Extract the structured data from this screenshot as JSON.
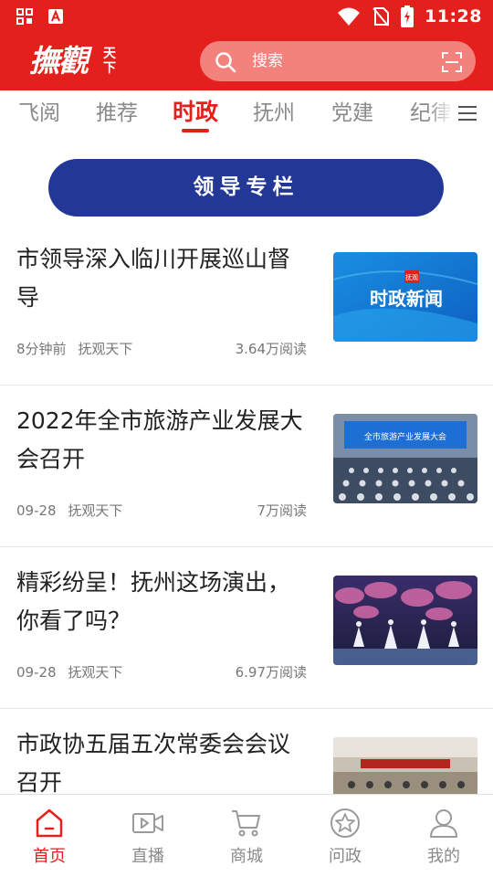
{
  "status_bar": {
    "time": "11:28",
    "left_icons": [
      "apps-icon",
      "a-logo-icon"
    ],
    "right_icons": [
      "wifi-icon",
      "no-sim-icon",
      "battery-charging-icon"
    ]
  },
  "header": {
    "logo_text": "撫觀",
    "logo_small_text": "天下",
    "search_placeholder": "搜索",
    "colors": {
      "brand_red": "#e3201b",
      "search_bg": "#f3827c"
    }
  },
  "tabs": {
    "items": [
      {
        "label": "飞阅",
        "active": false
      },
      {
        "label": "推荐",
        "active": false
      },
      {
        "label": "时政",
        "active": true
      },
      {
        "label": "抚州",
        "active": false
      },
      {
        "label": "党建",
        "active": false
      },
      {
        "label": "纪律",
        "active": false
      }
    ],
    "more_icon": "menu-icon"
  },
  "banner": {
    "label": "领导专栏",
    "color": "#223796"
  },
  "news": [
    {
      "title": "市领导深入临川开展巡山督导",
      "time": "8分钟前",
      "source": "抚观天下",
      "reads": "3.64万阅读",
      "thumb_logo": "抚观",
      "thumb_text": "时政新闻"
    },
    {
      "title": "2022年全市旅游产业发展大会召开",
      "time": "09-28",
      "source": "抚观天下",
      "reads": "7万阅读",
      "thumb_text": "全市旅游产业发展大会"
    },
    {
      "title": "精彩纷呈！抚州这场演出，你看了吗？",
      "time": "09-28",
      "source": "抚观天下",
      "reads": "6.97万阅读"
    },
    {
      "title": "市政协五届五次常委会会议召开",
      "time": "",
      "source": "",
      "reads": ""
    }
  ],
  "bottom_nav": [
    {
      "label": "首页",
      "icon": "home-icon",
      "active": true
    },
    {
      "label": "直播",
      "icon": "video-icon",
      "active": false
    },
    {
      "label": "商城",
      "icon": "cart-icon",
      "active": false
    },
    {
      "label": "问政",
      "icon": "badge-star-icon",
      "active": false
    },
    {
      "label": "我的",
      "icon": "user-icon",
      "active": false
    }
  ]
}
